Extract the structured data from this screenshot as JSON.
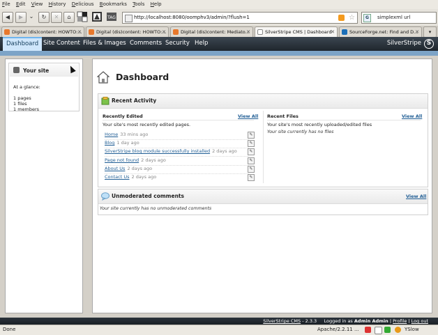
{
  "browser": {
    "menu": [
      "File",
      "Edit",
      "View",
      "History",
      "Delicious",
      "Bookmarks",
      "Tools",
      "Help"
    ],
    "url": "http://localhost:8080/oomphv3/admin/?flush=1",
    "search_value": "simplexml url",
    "search_engine_icon": "google-icon",
    "tabs": [
      {
        "label": "Digital (dis)content: HOWTO:...",
        "icon": "blogger-icon"
      },
      {
        "label": "Digital (dis)content: HOWTO:...",
        "icon": "blogger-icon"
      },
      {
        "label": "Digital (dis)content: Mediato...",
        "icon": "blogger-icon"
      },
      {
        "label": "SilverStripe CMS | Dashboard",
        "icon": "silverstripe-icon",
        "active": true
      },
      {
        "label": "SourceForge.net: Find and D...",
        "icon": "sourceforge-icon"
      }
    ],
    "status_text": "Done",
    "server_text": "Apache/2.2.11 ...",
    "yslow_label": "YSlow"
  },
  "cms": {
    "nav": [
      "Dashboard",
      "Site Content",
      "Files & Images",
      "Comments",
      "Security",
      "Help"
    ],
    "brand": "SilverStripe",
    "left_panel": {
      "title": "Your site",
      "glance": "At a glance:",
      "stats": [
        "1 pages",
        "1 files",
        "1 members"
      ]
    },
    "page_title": "Dashboard",
    "recent_activity": {
      "title": "Recent Activity",
      "edited": {
        "title": "Recently Edited",
        "view_all": "View All",
        "desc": "Your site's most recently edited pages.",
        "items": [
          {
            "name": "Home",
            "ago": "33 mins ago"
          },
          {
            "name": "Blog",
            "ago": "1 day ago"
          },
          {
            "name": "SilverStripe blog module successfully installed",
            "ago": "2 days ago"
          },
          {
            "name": "Page not found",
            "ago": "2 days ago"
          },
          {
            "name": "About Us",
            "ago": "2 days ago"
          },
          {
            "name": "Contact Us",
            "ago": "2 days ago"
          }
        ]
      },
      "files": {
        "title": "Recent Files",
        "view_all": "View All",
        "desc": "Your site's most recently uploaded/edited files",
        "empty": "Your site currently has no files"
      }
    },
    "comments": {
      "title": "Unmoderated comments",
      "view_all": "View All",
      "empty": "Your site currently has no unmoderated comments"
    },
    "footer": {
      "product": "SilverStripe CMS",
      "version": "- 2.3.3",
      "logged_prefix": "Logged in as",
      "user": "Admin Admin",
      "profile": "Profile",
      "logout": "Log out"
    }
  }
}
